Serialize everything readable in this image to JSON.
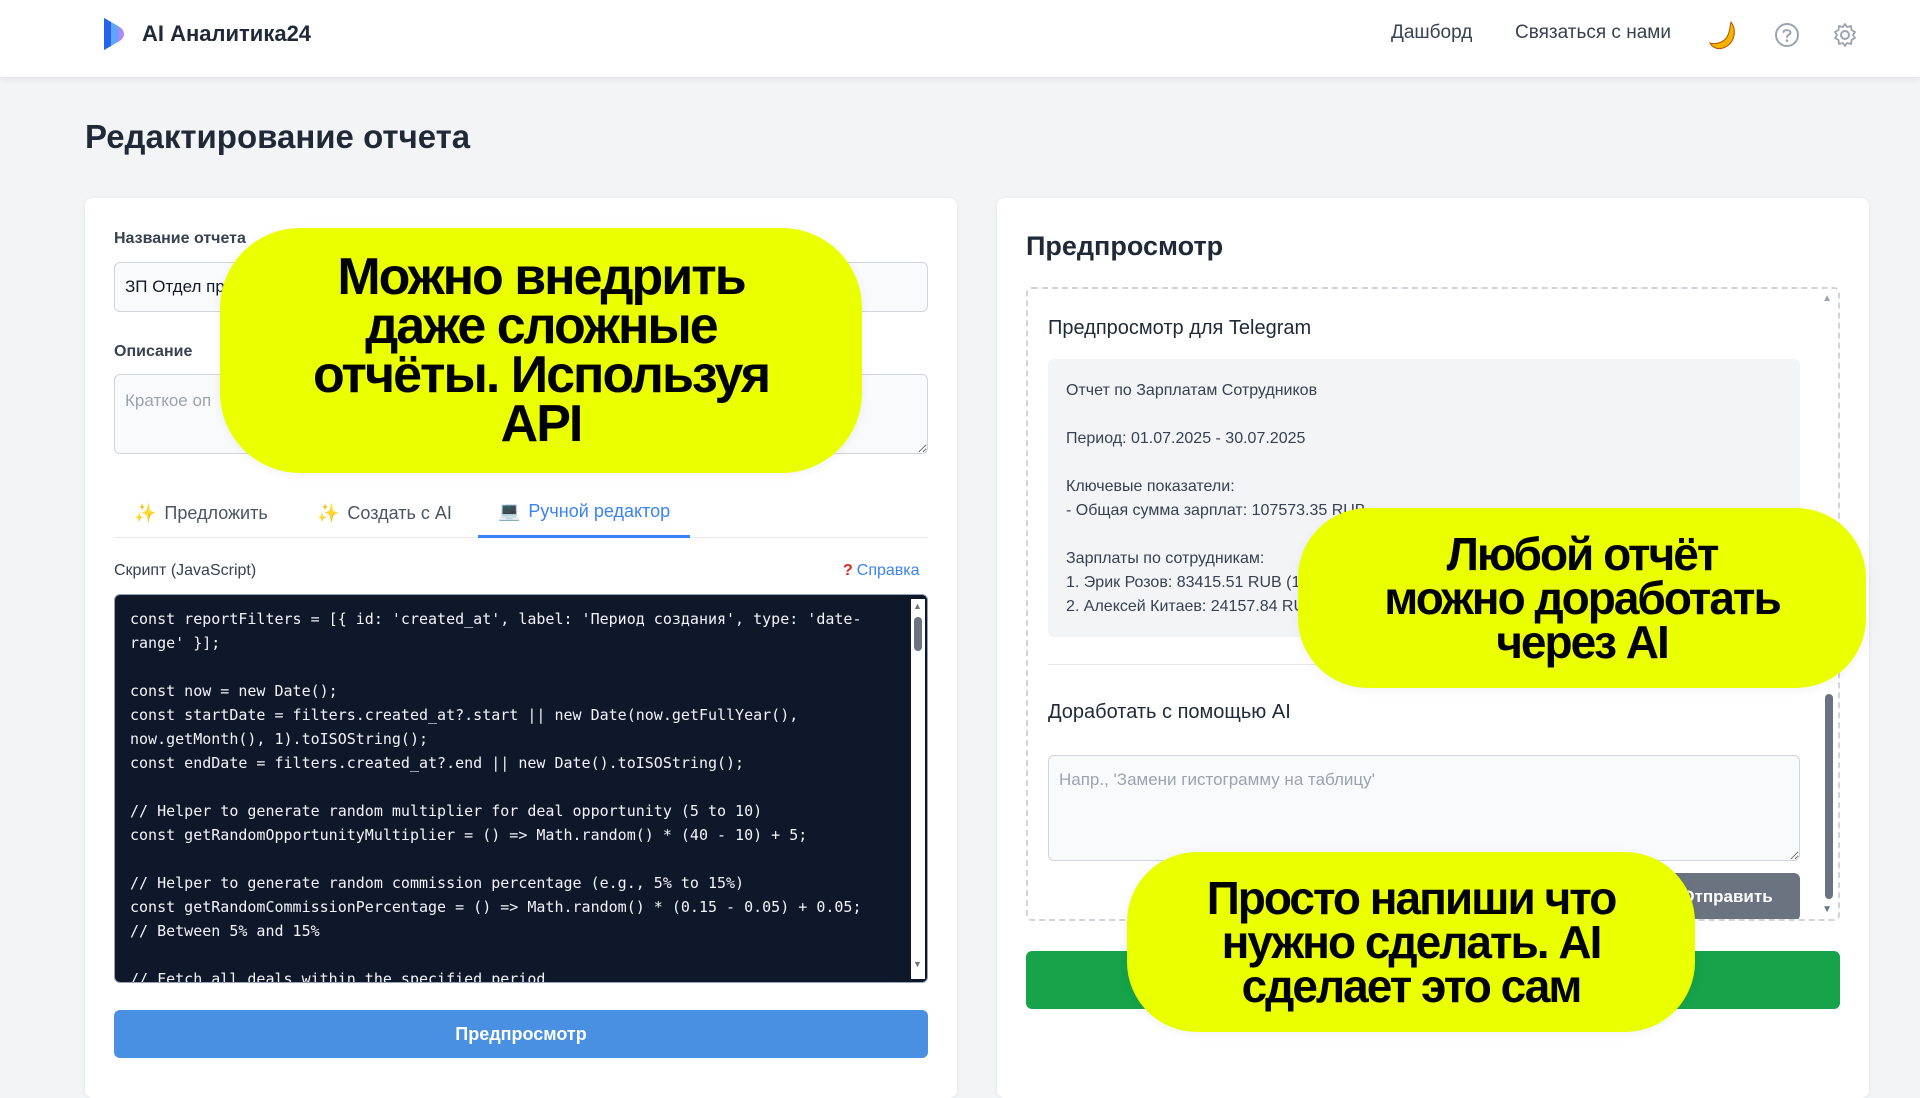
{
  "header": {
    "brand": "AI Аналитика24",
    "nav": {
      "dashboard": "Дашборд",
      "contact": "Связаться с нами"
    },
    "icons": {
      "theme": "moon-icon",
      "help": "help-icon",
      "settings": "gear-icon"
    },
    "logo_colors": [
      "#3b82f6",
      "#a855f7"
    ]
  },
  "page": {
    "title": "Редактирование отчета"
  },
  "form": {
    "name_label": "Название отчета",
    "name_value": "ЗП Отдел пр",
    "desc_label": "Описание",
    "desc_placeholder": "Краткое оп",
    "tabs": [
      {
        "icon": "✨",
        "label": "Предложить"
      },
      {
        "icon": "✨",
        "label": "Создать с AI"
      },
      {
        "icon": "💻",
        "label": "Ручной редактор"
      }
    ],
    "active_tab": "Ручной редактор",
    "script_label": "Скрипт (JavaScript)",
    "help_label": "Справка",
    "code": "const reportFilters = [{ id: 'created_at', label: 'Период создания', type: 'date-range' }];\n\nconst now = new Date();\nconst startDate = filters.created_at?.start || new Date(now.getFullYear(), now.getMonth(), 1).toISOString();\nconst endDate = filters.created_at?.end || new Date().toISOString();\n\n// Helper to generate random multiplier for deal opportunity (5 to 10)\nconst getRandomOpportunityMultiplier = () => Math.random() * (40 - 10) + 5;\n\n// Helper to generate random commission percentage (e.g., 5% to 15%)\nconst getRandomCommissionPercentage = () => Math.random() * (0.15 - 0.05) + 0.05;\n// Between 5% and 15%\n\n// Fetch all deals within the specified period",
    "preview_button": "Предпросмотр"
  },
  "preview": {
    "title": "Предпросмотр",
    "telegram_title": "Предпросмотр для Telegram",
    "telegram_lines": {
      "report": "Отчет по Зарплатам Сотрудников",
      "period": "Период: 01.07.2025 - 30.07.2025",
      "kpi_title": "Ключевые показатели:",
      "kpi_total": "- Общая сумма зарплат: 107573.35 RUB",
      "by_emp_title": "Зарплаты по сотрудникам:",
      "emp1": "1. Эрик Розов: 83415.51 RUB (1",
      "emp2": "2. Алексей Китаев: 24157.84 RU"
    },
    "ai_title": "Доработать с помощью AI",
    "ai_placeholder": "Напр., 'Замени гистограмму на таблицу'",
    "send_button": "Отправить",
    "save_button": ""
  },
  "promo": {
    "bubble1": [
      "Можно внедрить",
      "даже сложные",
      "отчёты. Используя",
      "API"
    ],
    "bubble2": [
      "Любой отчёт",
      "можно доработать",
      "через AI"
    ],
    "bubble3": [
      "Просто напиши что",
      "нужно сделать. AI",
      "сделает это сам"
    ],
    "color": "#eaff00"
  },
  "colors": {
    "accent": "#3b82f6",
    "primary_button": "#4a90e2",
    "success": "#16a34a",
    "code_bg": "#0f172a"
  }
}
